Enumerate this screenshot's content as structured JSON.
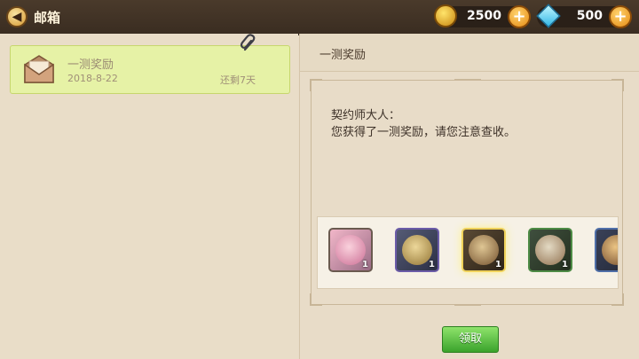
{
  "header": {
    "title": "邮箱",
    "gold": "2500",
    "gems": "500"
  },
  "mail_list": [
    {
      "title": "一测奖励",
      "date": "2018-8-22",
      "remaining": "还剩7天"
    }
  ],
  "mail_detail": {
    "title": "一测奖励",
    "salutation": "契约师大人：",
    "body": "您获得了一测奖励，请您注意查收。",
    "rewards": [
      {
        "icon": "character-portrait-icon",
        "count": "1"
      },
      {
        "icon": "gold-helmet-icon",
        "count": "1"
      },
      {
        "icon": "sword-icon",
        "count": "1"
      },
      {
        "icon": "scroll-staff-icon",
        "count": "1"
      },
      {
        "icon": "item-icon",
        "count": ""
      }
    ],
    "claim_label": "领取"
  },
  "colors": {
    "accent_gold": "#e58a12",
    "accent_green": "#3aa32c",
    "selected_mail_bg": "#e6f2a6"
  }
}
